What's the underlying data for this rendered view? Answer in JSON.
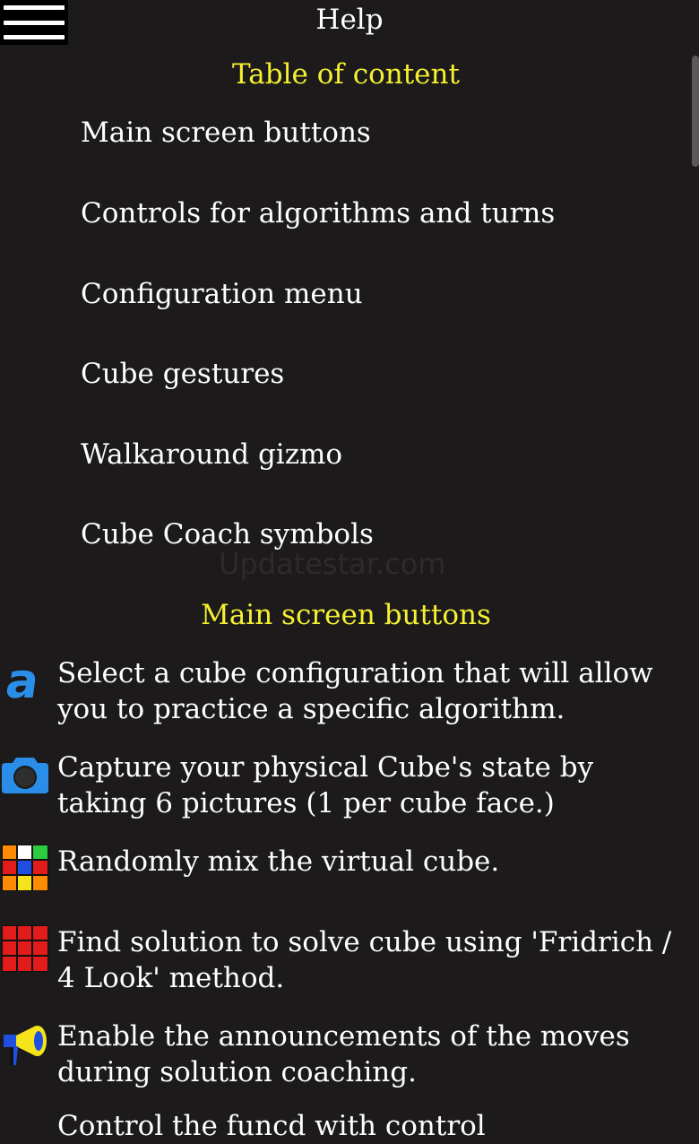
{
  "header": {
    "title": "Help",
    "menu_icon": "hamburger-menu-icon"
  },
  "toc": {
    "title": "Table of content",
    "items": [
      "Main screen buttons",
      "Controls for algorithms and turns",
      "Configuration menu",
      "Cube gestures",
      "Walkaround gizmo",
      "Cube Coach symbols"
    ]
  },
  "watermark": "Updatestar.com",
  "main_buttons": {
    "title": "Main screen buttons",
    "items": [
      {
        "icon": "algorithm-a-icon",
        "text": "Select a cube configuration that will allow you to practice a specific algorithm."
      },
      {
        "icon": "camera-icon",
        "text": "Capture your physical Cube's state by taking 6 pictures (1 per cube face.)"
      },
      {
        "icon": "scramble-cube-icon",
        "text": "Randomly mix the virtual cube."
      },
      {
        "icon": "solve-cube-icon",
        "text": "Find solution to solve cube using 'Fridrich / 4 Look' method."
      },
      {
        "icon": "megaphone-icon",
        "text": "Enable the announcements of the moves during solution coaching."
      }
    ],
    "partial_next": "Control the funcd with control"
  },
  "colors": {
    "background": "#1c1a1a",
    "section_title": "#f5f032",
    "text": "#ffffff",
    "icon_blue": "#2a8ee8",
    "cube_red": "#e21b1b"
  }
}
